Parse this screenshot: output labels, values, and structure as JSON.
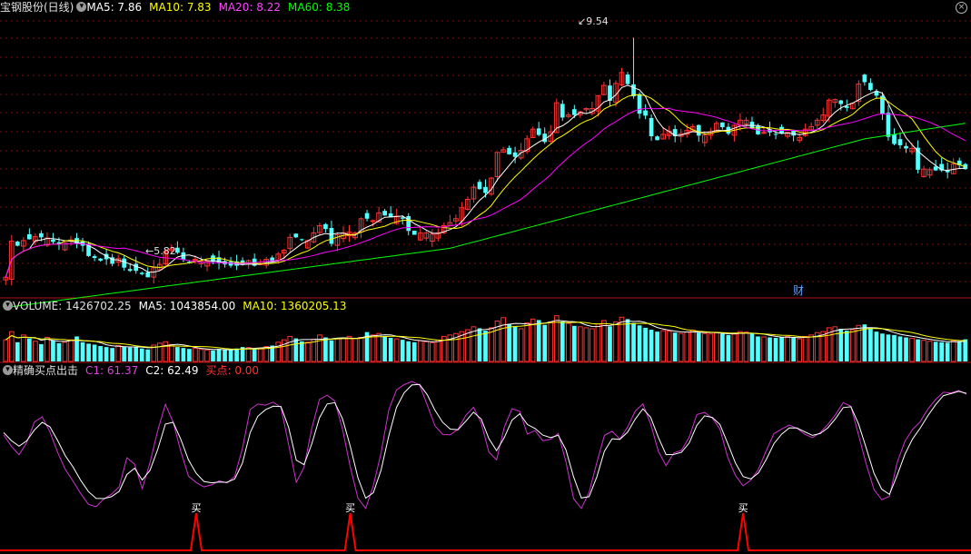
{
  "price_panel": {
    "stock_name": "宝钢股份(日线)",
    "ma5_label": "MA5: 7.86",
    "ma10_label": "MA10: 7.83",
    "ma20_label": "MA20: 8.22",
    "ma60_label": "MA60: 8.38",
    "high_label": "9.54",
    "low_label": "5.82",
    "fin_marker": "财"
  },
  "volume_panel": {
    "vol_label": "VOLUME: 1426702.25",
    "ma5_label": "MA5: 1043854.00",
    "ma10_label": "MA10: 1360205.13"
  },
  "indicator_panel": {
    "name": "精确买点出击",
    "c1_label": "C1: 61.37",
    "c2_label": "C2: 62.49",
    "buy_label": "买点: 0.00",
    "buy_marker": "买"
  },
  "colors": {
    "up": "#ff3333",
    "down": "#54ffff",
    "ma5": "#ffffff",
    "ma10": "#ffff00",
    "ma20": "#ff00ff",
    "ma60": "#00ff00",
    "c1": "#cc33cc",
    "c2": "#ffffff",
    "buy": "#ff0000",
    "grid": "#7a1010"
  },
  "chart_data": [
    {
      "type": "candlestick",
      "title": "宝钢股份(日线)",
      "ylim": [
        5.5,
        9.9
      ],
      "close": [
        5.82,
        6.38,
        6.31,
        6.39,
        6.41,
        6.45,
        6.44,
        6.43,
        6.37,
        6.34,
        6.36,
        6.4,
        6.34,
        6.31,
        6.15,
        6.12,
        6.08,
        6.1,
        6.03,
        6.11,
        5.97,
        5.92,
        5.92,
        5.87,
        5.82,
        5.97,
        6.02,
        6.22,
        6.26,
        6.2,
        6.09,
        6.06,
        6.1,
        6.07,
        6.07,
        6.06,
        6.04,
        6.02,
        6.0,
        6.0,
        6.02,
        6.08,
        6.0,
        6.03,
        6.1,
        6.06,
        6.18,
        6.24,
        6.44,
        6.44,
        6.41,
        6.39,
        6.51,
        6.62,
        6.57,
        6.34,
        6.48,
        6.51,
        6.52,
        6.51,
        6.73,
        6.73,
        6.7,
        6.82,
        6.78,
        6.75,
        6.77,
        6.73,
        6.54,
        6.48,
        6.51,
        6.51,
        6.49,
        6.51,
        6.62,
        6.67,
        6.73,
        6.9,
        7.03,
        7.22,
        7.19,
        7.13,
        7.36,
        7.76,
        7.8,
        7.73,
        7.69,
        7.79,
        7.97,
        8.12,
        8.03,
        7.92,
        8.08,
        8.53,
        8.3,
        8.34,
        8.34,
        8.39,
        8.44,
        8.44,
        8.64,
        8.8,
        8.56,
        8.83,
        9.0,
        8.82,
        8.63,
        8.36,
        8.33,
        8.01,
        7.95,
        8.04,
        8.09,
        8.01,
        8.05,
        8.1,
        8.16,
        8.02,
        8.03,
        8.08,
        8.21,
        8.15,
        8.05,
        8.18,
        8.26,
        8.26,
        8.14,
        8.04,
        8.07,
        8.07,
        8.04,
        8.05,
        8.07,
        8.02,
        7.99,
        8.12,
        8.16,
        8.26,
        8.34,
        8.57,
        8.58,
        8.51,
        8.45,
        8.52,
        8.82,
        8.85,
        8.73,
        8.64,
        8.36,
        8.0,
        7.89,
        7.87,
        7.82,
        7.82,
        7.49,
        7.5,
        7.49,
        7.48,
        7.48,
        7.45,
        7.58,
        7.56,
        7.5
      ],
      "high": 9.54,
      "low": 5.82,
      "series": [
        {
          "name": "MA5",
          "last": 7.86
        },
        {
          "name": "MA10",
          "last": 7.83
        },
        {
          "name": "MA20",
          "last": 8.22
        },
        {
          "name": "MA60",
          "last": 8.38
        }
      ]
    },
    {
      "type": "bar",
      "title": "VOLUME",
      "values": [
        0.45,
        0.62,
        0.4,
        0.55,
        0.48,
        0.42,
        0.36,
        0.5,
        0.44,
        0.38,
        0.4,
        0.45,
        0.52,
        0.4,
        0.37,
        0.35,
        0.32,
        0.3,
        0.28,
        0.33,
        0.31,
        0.29,
        0.3,
        0.27,
        0.25,
        0.34,
        0.38,
        0.41,
        0.35,
        0.3,
        0.28,
        0.26,
        0.27,
        0.25,
        0.24,
        0.23,
        0.26,
        0.25,
        0.24,
        0.27,
        0.3,
        0.29,
        0.27,
        0.28,
        0.31,
        0.33,
        0.4,
        0.45,
        0.52,
        0.48,
        0.42,
        0.4,
        0.46,
        0.55,
        0.5,
        0.44,
        0.47,
        0.49,
        0.52,
        0.48,
        0.5,
        0.61,
        0.55,
        0.58,
        0.53,
        0.49,
        0.47,
        0.45,
        0.42,
        0.4,
        0.43,
        0.41,
        0.39,
        0.44,
        0.52,
        0.55,
        0.58,
        0.62,
        0.66,
        0.72,
        0.69,
        0.64,
        0.7,
        0.84,
        0.91,
        0.78,
        0.72,
        0.68,
        0.8,
        0.88,
        0.86,
        0.76,
        0.82,
        0.95,
        0.83,
        0.79,
        0.74,
        0.72,
        0.7,
        0.68,
        0.78,
        0.85,
        0.73,
        0.82,
        0.92,
        0.88,
        0.8,
        0.75,
        0.7,
        0.66,
        0.62,
        0.64,
        0.63,
        0.6,
        0.58,
        0.61,
        0.65,
        0.6,
        0.58,
        0.57,
        0.6,
        0.58,
        0.55,
        0.57,
        0.62,
        0.61,
        0.58,
        0.52,
        0.51,
        0.5,
        0.49,
        0.5,
        0.52,
        0.49,
        0.47,
        0.52,
        0.55,
        0.6,
        0.62,
        0.7,
        0.72,
        0.68,
        0.64,
        0.66,
        0.75,
        0.77,
        0.69,
        0.62,
        0.58,
        0.56,
        0.55,
        0.52,
        0.5,
        0.48,
        0.46,
        0.44,
        0.42,
        0.41,
        0.4,
        0.39,
        0.43,
        0.42,
        0.46
      ],
      "series": [
        {
          "name": "VOLUME",
          "last": 1426702.25
        },
        {
          "name": "MA5",
          "last": 1043854.0
        },
        {
          "name": "MA10",
          "last": 1360205.13
        }
      ]
    },
    {
      "type": "line",
      "title": "精确买点出击",
      "ylim": [
        0,
        100
      ],
      "series": [
        {
          "name": "C1",
          "last": 61.37,
          "values": [
            60.7,
            52.4,
            46.2,
            55.1,
            70.2,
            74.0,
            63.1,
            48.1,
            35.5,
            26.9,
            17.8,
            9.8,
            8.1,
            13.7,
            17.2,
            22.7,
            44.0,
            39.3,
            21.3,
            40.4,
            63.8,
            83.2,
            70.2,
            48.7,
            30.5,
            25.8,
            22.6,
            24.1,
            27.1,
            25.5,
            30.3,
            50.9,
            79.4,
            83.4,
            82.6,
            84.8,
            81.0,
            53.5,
            26.0,
            36.9,
            65.4,
            86.8,
            89.9,
            85.6,
            64.8,
            37.3,
            14.2,
            6.8,
            23.6,
            47.4,
            79.1,
            93.8,
            97.7,
            100.0,
            97.5,
            82.6,
            67.4,
            61.0,
            60.8,
            65.0,
            75.1,
            81.1,
            69.4,
            48.2,
            42.4,
            66.5,
            80.0,
            78.1,
            61.4,
            63.9,
            56.5,
            57.5,
            61.7,
            41.1,
            13.9,
            6.8,
            18.5,
            40.3,
            60.4,
            63.4,
            57.7,
            66.5,
            78.3,
            83.6,
            68.8,
            48.7,
            38.2,
            47.5,
            49.4,
            59.0,
            75.7,
            77.3,
            73.0,
            65.1,
            44.5,
            31.1,
            23.4,
            27.6,
            35.6,
            49.0,
            61.7,
            65.1,
            68.0,
            65.6,
            61.3,
            58.7,
            62.5,
            68.4,
            75.6,
            84.5,
            81.7,
            60.4,
            39.0,
            20.7,
            13.2,
            15.6,
            40.4,
            56.0,
            64.7,
            70.5,
            79.8,
            86.7,
            92.1,
            91.6,
            93.4,
            90.6
          ]
        },
        {
          "name": "C2",
          "last": 62.49,
          "values": [
            62.5,
            56.6,
            52.5,
            56.4,
            64.4,
            70.0,
            66.7,
            56.7,
            45.6,
            37.3,
            27.5,
            19.2,
            14.2,
            14.0,
            15.4,
            19.3,
            31.7,
            36.3,
            27.7,
            34.7,
            50.0,
            68.7,
            70.0,
            57.6,
            42.4,
            32.6,
            26.6,
            25.6,
            26.2,
            25.9,
            28.4,
            40.1,
            62.4,
            74.4,
            79.3,
            81.8,
            81.6,
            66.2,
            42.2,
            38.9,
            54.0,
            73.3,
            83.5,
            84.4,
            72.6,
            52.5,
            29.2,
            14.3,
            18.3,
            34.8,
            60.0,
            80.9,
            91.7,
            97.4,
            97.8,
            90.2,
            78.8,
            69.9,
            65.0,
            64.6,
            70.8,
            77.5,
            72.4,
            58.1,
            49.2,
            58.8,
            71.6,
            76.3,
            68.4,
            65.5,
            60.6,
            58.8,
            60.5,
            49.9,
            29.9,
            14.5,
            15.4,
            29.8,
            48.8,
            57.9,
            57.5,
            62.7,
            72.4,
            79.9,
            73.7,
            58.9,
            46.3,
            46.4,
            47.9,
            54.7,
            67.8,
            74.7,
            73.6,
            68.4,
            54.6,
            40.3,
            30.2,
            28.5,
            32.8,
            42.6,
            54.3,
            61.3,
            65.9,
            65.8,
            63.1,
            60.4,
            61.7,
            65.9,
            72.6,
            80.8,
            81.4,
            68.6,
            50.8,
            32.6,
            20.9,
            17.1,
            31.1,
            46.5,
            57.7,
            65.7,
            74.9,
            82.9,
            89.6,
            91.1,
            92.7,
            91.3
          ]
        },
        {
          "name": "买点",
          "last": 0.0,
          "peaks_at_index": [
            25,
            45,
            96
          ]
        }
      ]
    }
  ]
}
